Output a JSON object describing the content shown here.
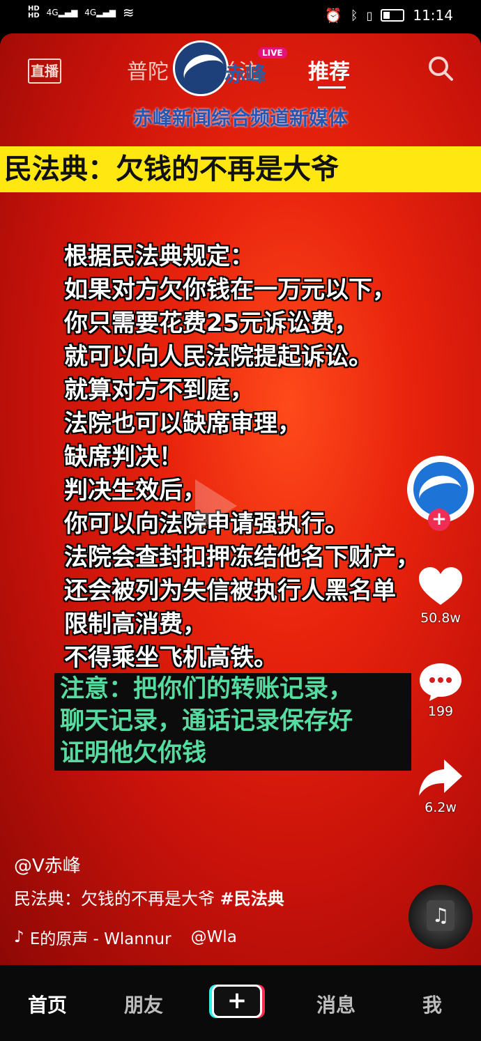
{
  "status_bar": {
    "hd1": "HD",
    "hd2": "HD",
    "net1": "4G",
    "net2": "4G",
    "time": "11:14",
    "battery_level": 0.35
  },
  "top_nav": {
    "live_label": "直播",
    "tabs": [
      {
        "label": "普陀"
      },
      {
        "label": "关注"
      },
      {
        "label": "推荐"
      }
    ],
    "live_badge": "LIVE"
  },
  "video": {
    "logo_text": "赤峰",
    "channel_name": "赤峰新闻综合频道新媒体",
    "banner": "民法典：欠钱的不再是大爷",
    "lines": [
      "根据民法典规定：",
      "如果对方欠你钱在一万元以下，",
      "你只需要花费25元诉讼费，",
      "就可以向人民法院提起诉讼。",
      "就算对方不到庭，",
      "法院也可以缺席审理，",
      "缺席判决！",
      "判决生效后，",
      "你可以向法院申请强执行。",
      "法院会查封扣押冻结他名下财产，",
      "还会被列为失信被执行人黑名单",
      "限制高消费，",
      "不得乘坐飞机高铁。"
    ],
    "note_lines": [
      "注意：把你们的转账记录，",
      "聊天记录，通话记录保存好",
      "证明他欠你钱"
    ]
  },
  "actions": {
    "likes": "50.8w",
    "comments": "199",
    "shares": "6.2w"
  },
  "meta": {
    "username": "@V赤峰",
    "caption_text": "民法典：欠钱的不再是大爷 ",
    "caption_tag": "#民法典",
    "music_text": "E的原声 - Wlannur",
    "music_mention": "@Wla"
  },
  "bottom_nav": {
    "home": "首页",
    "friends": "朋友",
    "plus": "+",
    "messages": "消息",
    "me": "我"
  },
  "colors": {
    "banner_yellow": "#ffe812",
    "note_green": "#56dba0",
    "live_pink": "#e6147a",
    "follow_red": "#f02e55"
  }
}
